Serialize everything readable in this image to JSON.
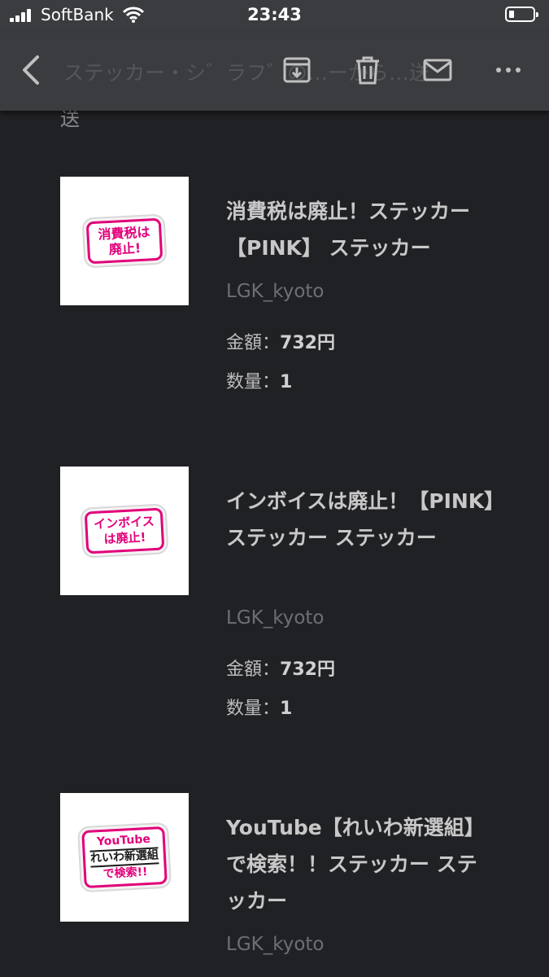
{
  "status_bar": {
    "carrier": "SoftBank",
    "time": "23:43"
  },
  "toolbar": {
    "title": "ステッカー・シ゛ラフ゛の…ーから…送",
    "icons": [
      "back-icon",
      "archive-icon",
      "trash-icon",
      "mail-icon",
      "more-icon"
    ]
  },
  "email": {
    "subject_tail": "送",
    "items": [
      {
        "sticker_text": "消費税は廃止!",
        "name": "消費税は廃止！ステッカー【PINK】 ステッカー",
        "seller": "LGK_kyoto",
        "price_label": "金額：",
        "price": "732円",
        "qty_label": "数量：",
        "qty": "1"
      },
      {
        "sticker_text": "インボイスは廃止!",
        "name": "インボイスは廃止！【PINK】ステッカー ステッカー",
        "seller": "LGK_kyoto",
        "price_label": "金額：",
        "price": "732円",
        "qty_label": "数量：",
        "qty": "1"
      },
      {
        "sticker_line1": "YouTube",
        "sticker_line2": "れいわ新選組",
        "sticker_line3": "で検索!!",
        "name": "YouTube【れいわ新選組】で検索！！ステッカー ステッカー",
        "seller": "LGK_kyoto"
      }
    ]
  },
  "colors": {
    "background": "#202124",
    "bars": "#3b3c3f",
    "sticker_pink": "#e2007a"
  }
}
